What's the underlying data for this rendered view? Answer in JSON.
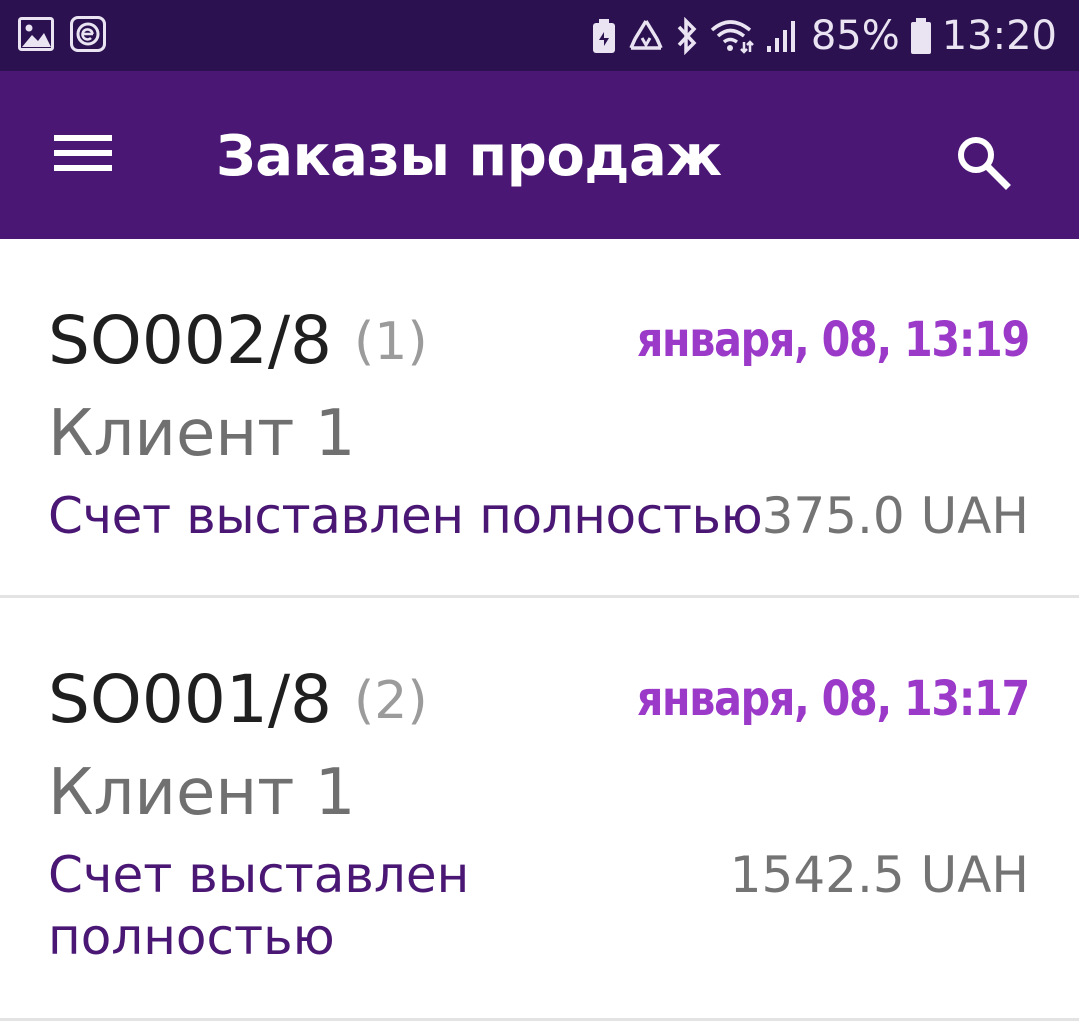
{
  "status_bar": {
    "left_icons": [
      "image-icon",
      "e-badge-icon"
    ],
    "right_icons": [
      "battery-saver-icon",
      "recycle-icon",
      "bluetooth-icon",
      "wifi-icon",
      "signal-icon"
    ],
    "battery_percent": "85%",
    "time": "13:20"
  },
  "app_bar": {
    "title": "Заказы продаж",
    "menu_icon": "menu-icon",
    "search_icon": "search-icon"
  },
  "orders": [
    {
      "number": "SO002/8",
      "count": "(1)",
      "date": "января, 08, 13:19",
      "client": "Клиент 1",
      "status": "Счет выставлен полностью",
      "amount": "375.0 UAH"
    },
    {
      "number": "SO001/8",
      "count": "(2)",
      "date": "января, 08, 13:17",
      "client": "Клиент 1",
      "status": "Счет выставлен полностью",
      "amount": "1542.5 UAH"
    }
  ],
  "colors": {
    "status_bar_bg": "#2b1150",
    "app_bar_bg": "#4a1775",
    "date_color": "#9b39c9",
    "status_color": "#4a1775"
  }
}
